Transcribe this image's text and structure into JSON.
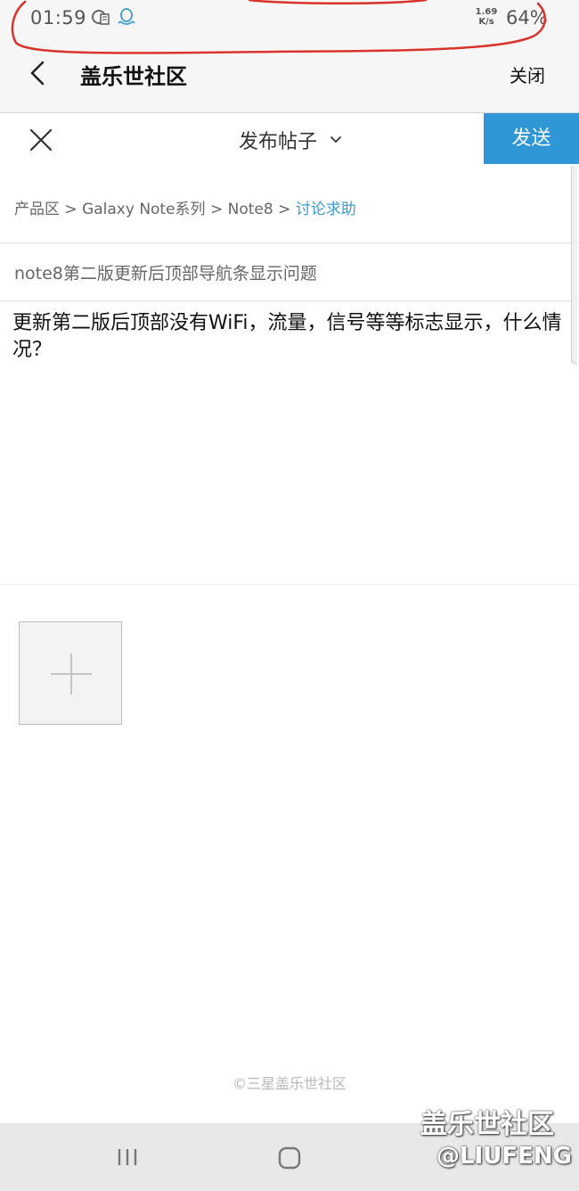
{
  "status_bar": {
    "time": "01:59",
    "network_speed_value": "1.69",
    "network_speed_unit": "K/s",
    "battery": "64%"
  },
  "header": {
    "title": "盖乐世社区",
    "close_label": "关闭"
  },
  "composer": {
    "title": "发布帖子",
    "send_label": "发送"
  },
  "breadcrumb": {
    "items": [
      "产品区",
      "Galaxy Note系列",
      "Note8"
    ],
    "current": "讨论求助",
    "separator": ">"
  },
  "post": {
    "title": "note8第二版更新后顶部导航条显示问题",
    "body": "更新第二版后顶部没有WiFi，流量，信号等等标志显示，什么情况？"
  },
  "footer": {
    "copyright": "©三星盖乐世社区"
  },
  "watermark": {
    "site": "盖乐世社区",
    "user": "@LIUFENG"
  },
  "colors": {
    "accent": "#2f97d5",
    "breadcrumb_active": "#3a9bd0",
    "annotation_red": "#d9342b"
  },
  "icons": {
    "status": [
      "sim-card-icon",
      "qq-icon"
    ],
    "header": [
      "back-arrow-icon"
    ],
    "composer": [
      "close-icon",
      "chevron-down-icon"
    ],
    "upload": "plus-icon",
    "nav": [
      "recent-apps-icon",
      "home-icon"
    ]
  }
}
